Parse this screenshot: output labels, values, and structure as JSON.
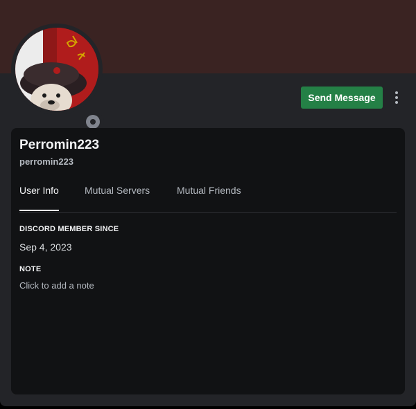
{
  "profile": {
    "display_name": "Perromin223",
    "username": "perromin223",
    "status": "offline"
  },
  "actions": {
    "send_message_label": "Send Message"
  },
  "tabs": [
    {
      "label": "User Info",
      "active": true
    },
    {
      "label": "Mutual Servers",
      "active": false
    },
    {
      "label": "Mutual Friends",
      "active": false
    }
  ],
  "user_info": {
    "member_since_title": "DISCORD MEMBER SINCE",
    "member_since_value": "Sep 4, 2023",
    "note_title": "NOTE",
    "note_placeholder": "Click to add a note"
  },
  "colors": {
    "banner": "#3a2322",
    "button": "#248046",
    "card": "#232428",
    "panel": "#111214"
  }
}
